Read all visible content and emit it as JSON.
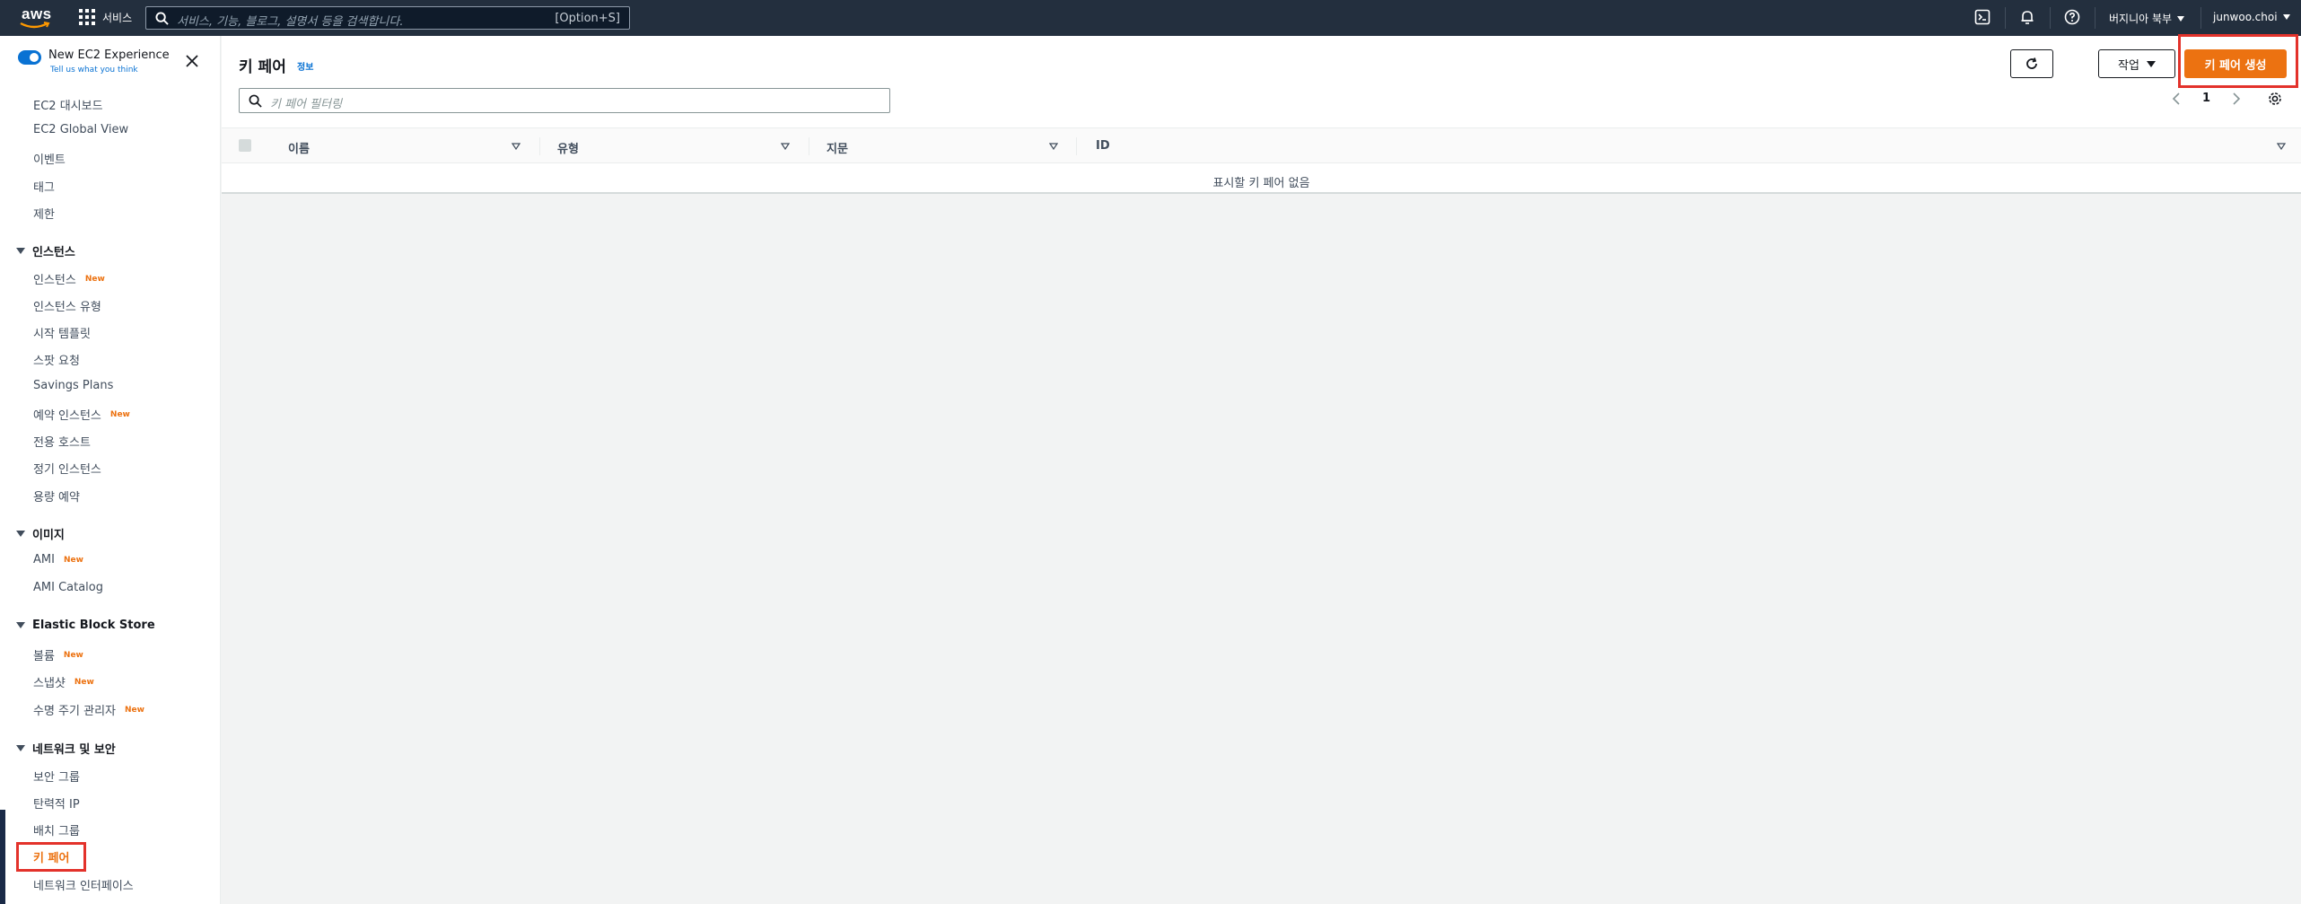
{
  "topnav": {
    "logo_text": "aws",
    "services_label": "서비스",
    "search_placeholder": "서비스, 기능, 블로그, 설명서 등을 검색합니다.",
    "search_hint": "[Option+S]",
    "region_label": "버지니아 북부",
    "user_label": "junwoo.choi"
  },
  "sidebar": {
    "experience_title": "New EC2 Experience",
    "experience_sub": "Tell us what you think",
    "new_badge": "New",
    "top_items": [
      "EC2 대시보드",
      "EC2 Global View",
      "이벤트",
      "태그",
      "제한"
    ],
    "sections": {
      "instances": {
        "title": "인스턴스",
        "items": [
          "인스턴스",
          "인스턴스 유형",
          "시작 템플릿",
          "스팟 요청",
          "Savings Plans",
          "예약 인스턴스",
          "전용 호스트",
          "정기 인스턴스",
          "용량 예약"
        ]
      },
      "images": {
        "title": "이미지",
        "items": [
          "AMI",
          "AMI Catalog"
        ]
      },
      "ebs": {
        "title": "Elastic Block Store",
        "items": [
          "볼륨",
          "스냅샷",
          "수명 주기 관리자"
        ]
      },
      "network": {
        "title": "네트워크 및 보안",
        "items": [
          "보안 그룹",
          "탄력적 IP",
          "배치 그룹",
          "키 페어",
          "네트워크 인터페이스"
        ]
      }
    }
  },
  "main": {
    "title": "키 페어",
    "info_link": "정보",
    "action_label": "작업",
    "create_label": "키 페어 생성",
    "filter_placeholder": "키 페어 필터링",
    "page_number": "1",
    "columns": [
      "이름",
      "유형",
      "지문",
      "ID"
    ],
    "empty_message": "표시할 키 페어 없음"
  },
  "colors": {
    "nav_bg": "#232f3e",
    "accent_orange": "#ec7211",
    "link_blue": "#0972d3",
    "highlight_red": "#e3322b"
  }
}
